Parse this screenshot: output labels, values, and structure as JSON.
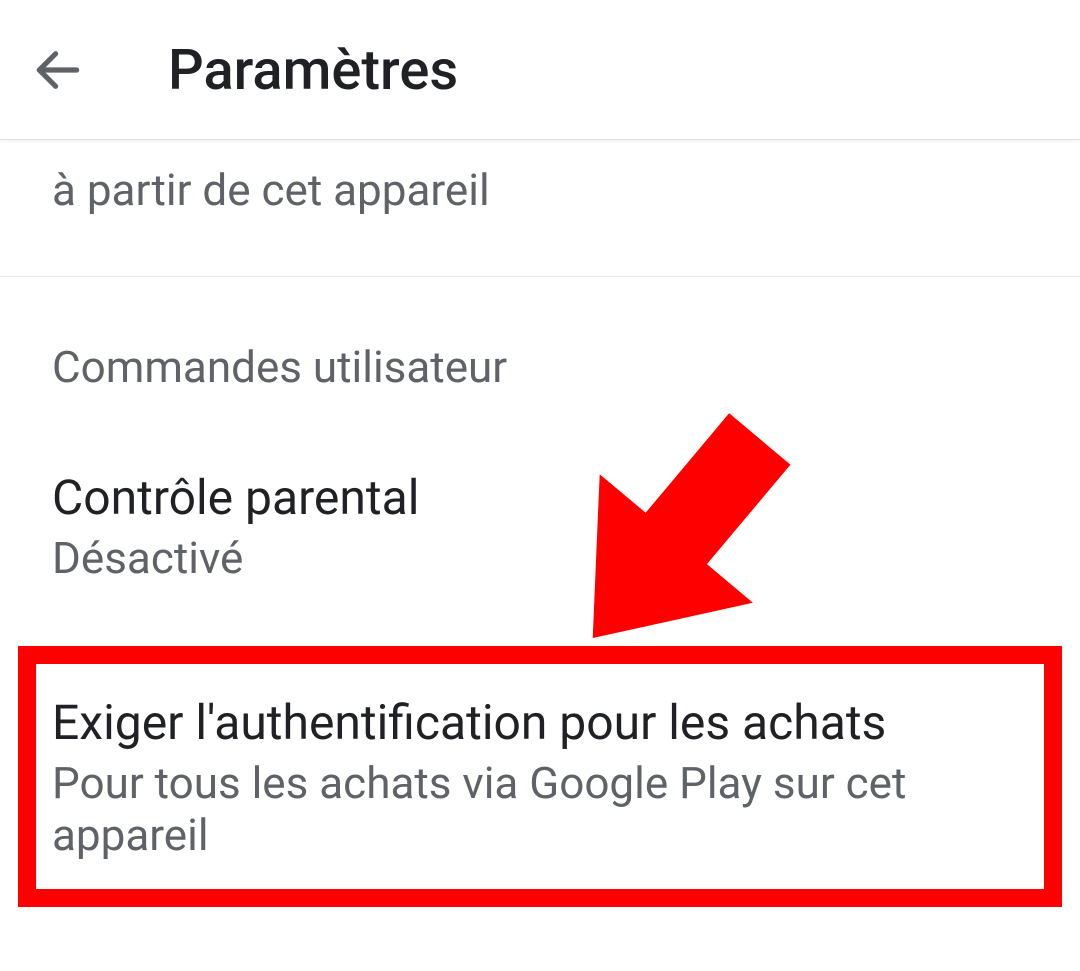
{
  "header": {
    "title": "Paramètres"
  },
  "truncated": {
    "subtitle": "à partir de cet appareil"
  },
  "section": {
    "header": "Commandes utilisateur",
    "items": [
      {
        "title": "Contrôle parental",
        "subtitle": "Désactivé"
      },
      {
        "title": "Exiger l'authentification pour les achats",
        "subtitle": "Pour tous les achats via Google Play sur cet appareil"
      }
    ]
  },
  "annotations": {
    "arrow_color": "#ff0000",
    "highlight_color": "#ff0000"
  }
}
